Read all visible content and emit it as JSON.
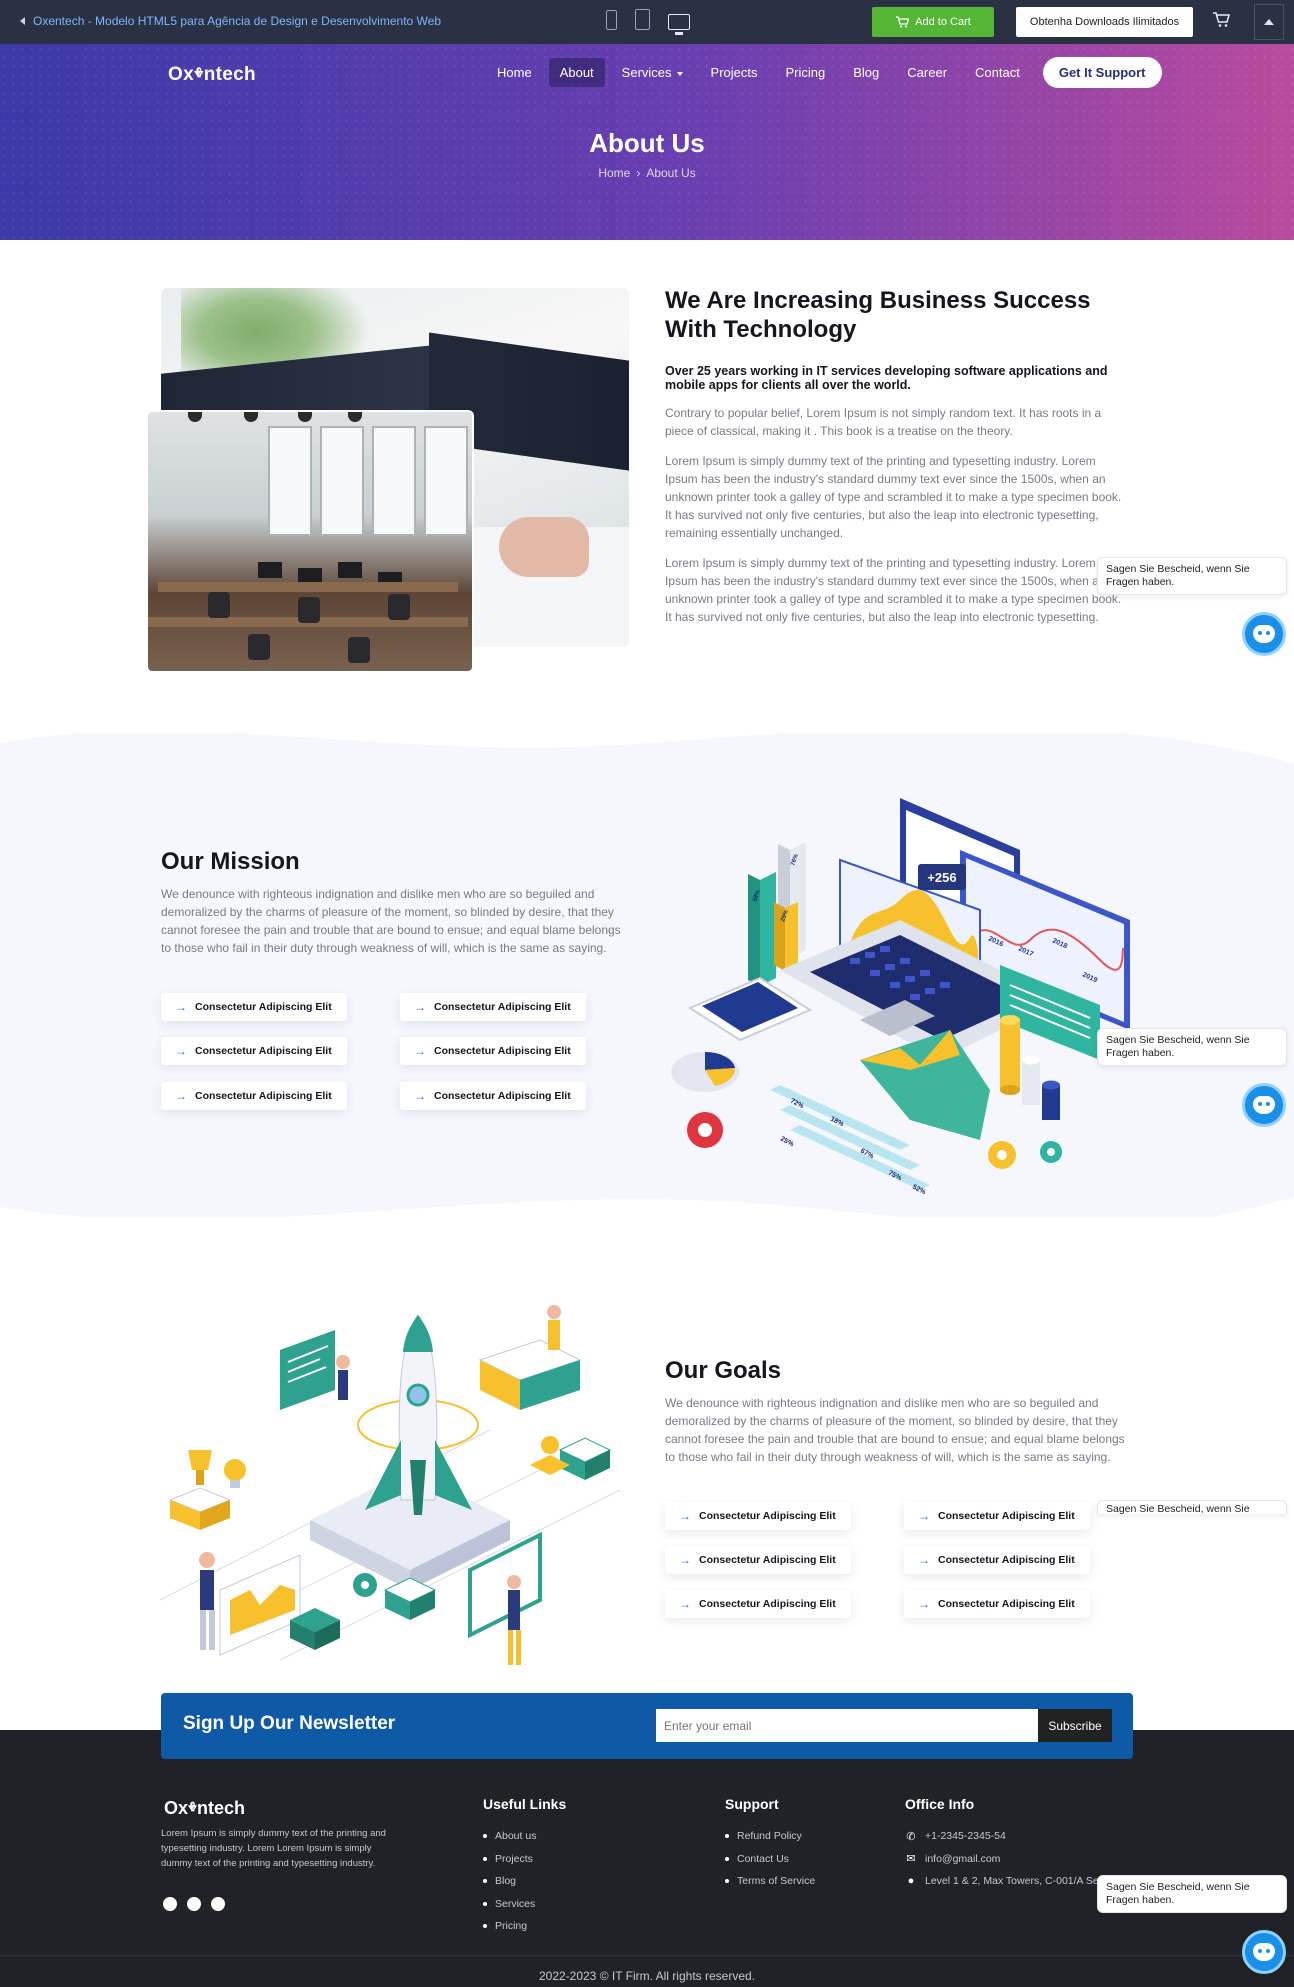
{
  "preview_bar": {
    "back_text": "Oxentech - Modelo HTML5 para Agência de Design e Desenvolvimento Web",
    "add_to_cart": "Add to Cart",
    "downloads": "Obtenha Downloads Ilimitados"
  },
  "header": {
    "logo": "Oxⰷntech",
    "nav": [
      "Home",
      "About",
      "Services",
      "Projects",
      "Pricing",
      "Blog",
      "Career",
      "Contact"
    ],
    "active_nav": "About",
    "cta": "Get It Support"
  },
  "hero": {
    "title": "About Us",
    "breadcrumb": [
      "Home",
      "About Us"
    ],
    "separator": "›"
  },
  "about": {
    "heading": "We Are Increasing Business Success With Technology",
    "lead": "Over 25 years working in IT services developing software applications and mobile apps for clients all over the world.",
    "p1": "Contrary to popular belief, Lorem Ipsum is not simply random text. It has roots in a piece of classical, making it . This book is a treatise on the theory.",
    "p2": "Lorem Ipsum is simply dummy text of the printing and typesetting industry. Lorem Ipsum has been the industry's standard dummy text ever since the 1500s, when an unknown printer took a galley of type and scrambled it to make a type specimen book. It has survived not only five centuries, but also the leap into electronic typesetting, remaining essentially unchanged.",
    "p3": "Lorem Ipsum is simply dummy text of the printing and typesetting industry. Lorem Ipsum has been the industry's standard dummy text ever since the 1500s, when an unknown printer took a galley of type and scrambled it to make a type specimen book. It has survived not only five centuries, but also the leap into electronic typesetting."
  },
  "mission": {
    "title": "Our Mission",
    "body": "We denounce with righteous indignation and dislike men who are so beguiled and demoralized by the charms of pleasure of the moment, so blinded by desire, that they cannot foresee the pain and trouble that are bound to ensue; and equal blame belongs to those who fail in their duty through weakness of will, which is the same as saying.",
    "chips": [
      "Consectetur Adipiscing Elit",
      "Consectetur Adipiscing Elit",
      "Consectetur Adipiscing Elit",
      "Consectetur Adipiscing Elit",
      "Consectetur Adipiscing Elit",
      "Consectetur Adipiscing Elit"
    ],
    "illustration_badge": "+256",
    "illustration_years": [
      "2016",
      "2017",
      "2018",
      "2019"
    ],
    "illustration_percents": [
      "58%",
      "76%",
      "25%",
      "72%",
      "18%",
      "67%",
      "75%",
      "25%",
      "52%"
    ]
  },
  "goals": {
    "title": "Our Goals",
    "body": "We denounce with righteous indignation and dislike men who are so beguiled and demoralized by the charms of pleasure of the moment, so blinded by desire, that they cannot foresee the pain and trouble that are bound to ensue; and equal blame belongs to those who fail in their duty through weakness of will, which is the same as saying.",
    "chips": [
      "Consectetur Adipiscing Elit",
      "Consectetur Adipiscing Elit",
      "Consectetur Adipiscing Elit",
      "Consectetur Adipiscing Elit",
      "Consectetur Adipiscing Elit",
      "Consectetur Adipiscing Elit"
    ]
  },
  "chat": {
    "message": "Sagen Sie Bescheid, wenn Sie Fragen haben.",
    "message_clipped": "Sagen Sie Bescheid, wenn Sie"
  },
  "newsletter": {
    "title": "Sign Up Our Newsletter",
    "placeholder": "Enter your email",
    "button": "Subscribe"
  },
  "footer": {
    "logo": "Oxⰷntech",
    "description": "Lorem Ipsum is simply dummy text of the printing and typesetting industry. Lorem Lorem Ipsum is simply dummy text of the printing and typesetting industry.",
    "useful_links_title": "Useful Links",
    "useful_links": [
      "About us",
      "Projects",
      "Blog",
      "Services",
      "Pricing"
    ],
    "support_title": "Support",
    "support_links": [
      "Refund Policy",
      "Contact Us",
      "Terms of Service"
    ],
    "office_title": "Office Info",
    "office": {
      "phone": "+1-2345-2345-54",
      "email": "info@gmail.com",
      "address": "Level 1 & 2, Max Towers, C-001/A Sector 16 B"
    },
    "copyright": "2022-2023 © IT Firm. All rights reserved."
  },
  "colors": {
    "accent_green": "#55b535",
    "newsletter_blue": "#0f5aa6",
    "chip_arrow": "#2f6bdc",
    "footer_bg": "#202227"
  },
  "icons": [
    "cart-icon",
    "phone-device-icon",
    "tablet-device-icon",
    "desktop-device-icon",
    "scroll-up-icon",
    "chat-bot-icon",
    "facebook-icon",
    "twitter-icon",
    "instagram-icon",
    "phone-icon",
    "mail-icon",
    "location-pin-icon"
  ]
}
